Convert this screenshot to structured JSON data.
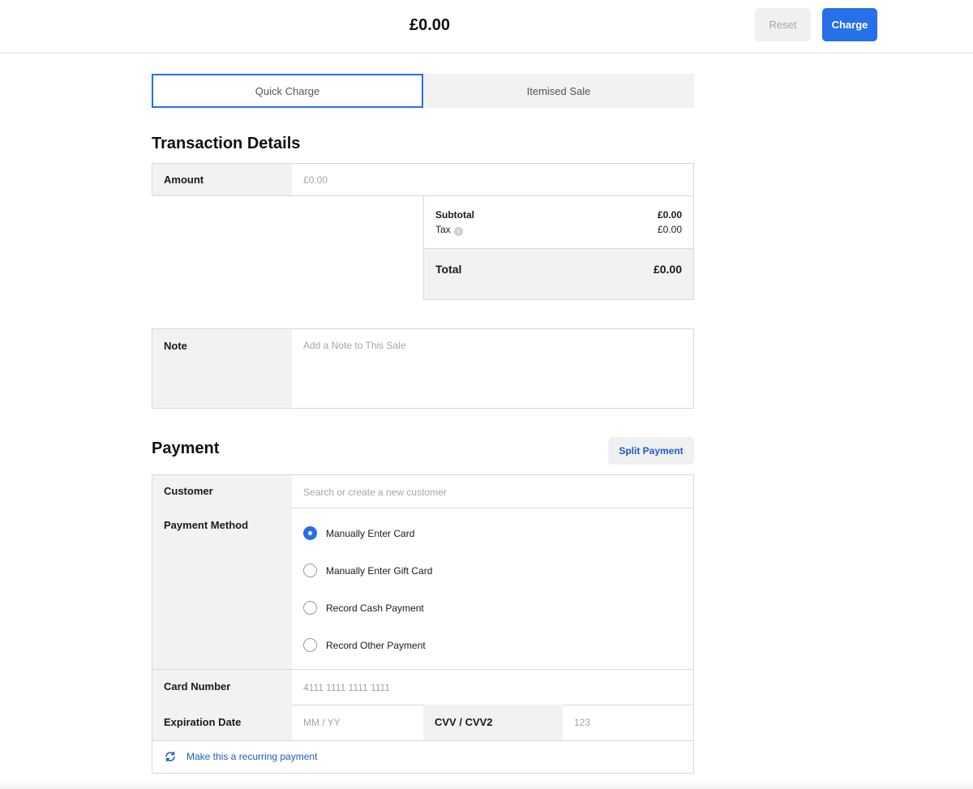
{
  "header": {
    "total": "£0.00",
    "reset_label": "Reset",
    "charge_label": "Charge"
  },
  "tabs": [
    {
      "label": "Quick Charge",
      "active": true
    },
    {
      "label": "Itemised Sale",
      "active": false
    }
  ],
  "transaction": {
    "title": "Transaction Details",
    "amount_label": "Amount",
    "amount_placeholder": "£0.00",
    "subtotal_label": "Subtotal",
    "subtotal_value": "£0.00",
    "tax_label": "Tax",
    "tax_value": "£0.00",
    "total_label": "Total",
    "total_value": "£0.00",
    "note_label": "Note",
    "note_placeholder": "Add a Note to This Sale"
  },
  "payment": {
    "title": "Payment",
    "split_label": "Split Payment",
    "customer_label": "Customer",
    "customer_placeholder": "Search or create a new customer",
    "method_label": "Payment Method",
    "methods": [
      {
        "label": "Manually Enter Card",
        "checked": true
      },
      {
        "label": "Manually Enter Gift Card",
        "checked": false
      },
      {
        "label": "Record Cash Payment",
        "checked": false
      },
      {
        "label": "Record Other Payment",
        "checked": false
      }
    ],
    "card_number_label": "Card Number",
    "card_number_placeholder": "4111 1111 1111 1111",
    "expiration_label": "Expiration Date",
    "expiration_placeholder": "MM / YY",
    "cvv_label": "CVV / CVV2",
    "cvv_placeholder": "123",
    "recurring_label": "Make this a recurring payment"
  },
  "colors": {
    "accent": "#2670e8",
    "link": "#1f5cc4",
    "panel": "#f2f2f2",
    "border": "#d9d9d9"
  }
}
